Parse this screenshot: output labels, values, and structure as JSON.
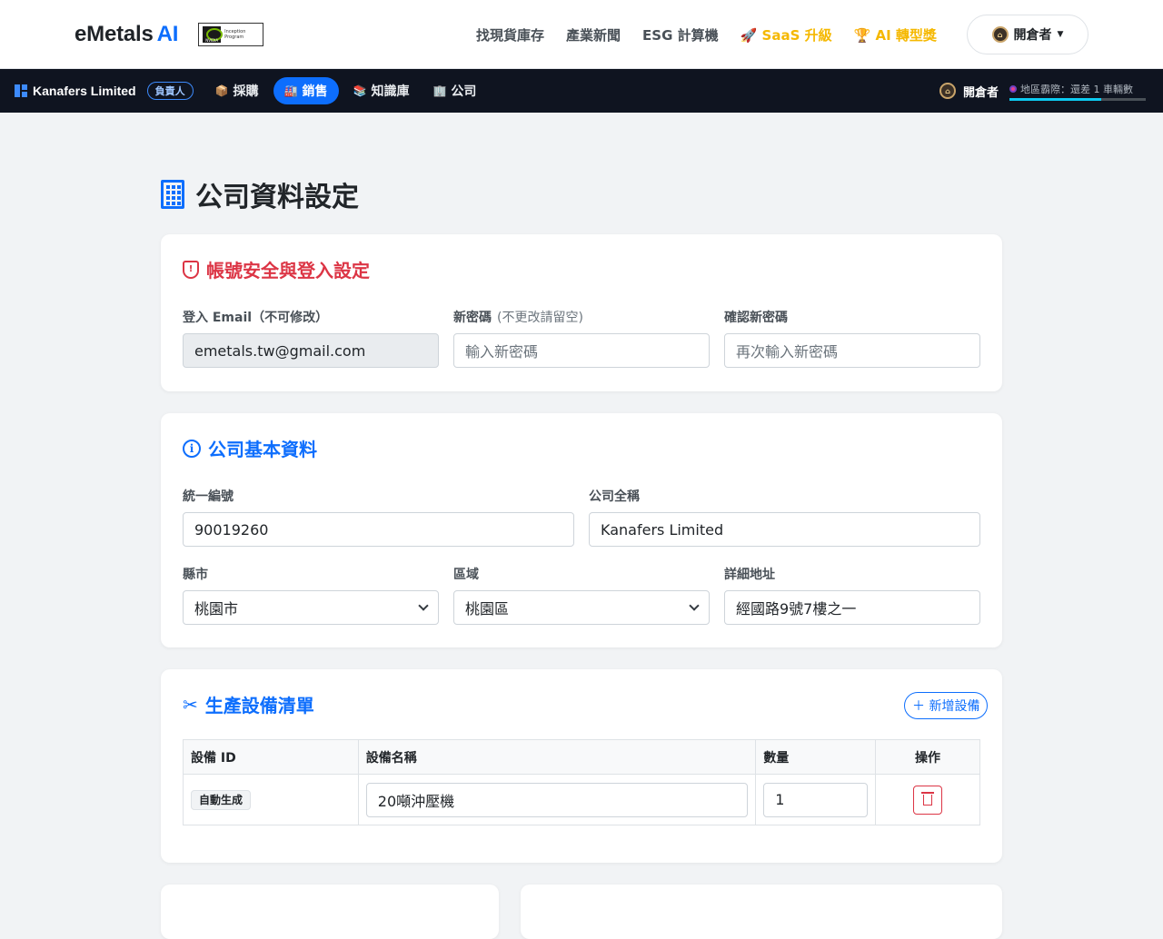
{
  "header": {
    "brand": "eMetals",
    "brand_ai": "AI",
    "badge_brand": "NVIDIA",
    "badge_text": "Inception Program",
    "nav": [
      {
        "label": "找現貨庫存"
      },
      {
        "label": "產業新聞"
      },
      {
        "label": "ESG 計算機"
      },
      {
        "label": "🚀 SaaS 升級"
      },
      {
        "label": "🏆 AI 轉型獎"
      }
    ],
    "user_label": "開倉者"
  },
  "subnav": {
    "company": "Kanafers Limited",
    "role": "負責人",
    "tabs": [
      {
        "icon": "📦",
        "label": "採購"
      },
      {
        "icon": "🏭",
        "label": "銷售"
      },
      {
        "icon": "📚",
        "label": "知識庫"
      },
      {
        "icon": "🏢",
        "label": "公司"
      }
    ],
    "user_label": "開倉者",
    "progress_text": "地區霸際：還差 1 車輛數",
    "progress_fraction": 0.67
  },
  "page": {
    "title": "公司資料設定"
  },
  "security": {
    "title": "帳號安全與登入設定",
    "email_label": "登入 Email（不可修改）",
    "email_value": "emetals.tw@gmail.com",
    "new_password_label": "新密碼",
    "new_password_hint": "(不更改請留空)",
    "new_password_placeholder": "輸入新密碼",
    "confirm_password_label": "確認新密碼",
    "confirm_password_placeholder": "再次輸入新密碼"
  },
  "company_info": {
    "title": "公司基本資料",
    "tax_id_label": "統一編號",
    "tax_id_value": "90019260",
    "full_name_label": "公司全稱",
    "full_name_value": "Kanafers Limited",
    "city_label": "縣市",
    "city_value": "桃園市",
    "district_label": "區域",
    "district_value": "桃園區",
    "address_label": "詳細地址",
    "address_value": "經國路9號7樓之一"
  },
  "equipment": {
    "title": "生產設備清單",
    "add_label": "＋ 新增設備",
    "columns": [
      "設備 ID",
      "設備名稱",
      "數量",
      "操作"
    ],
    "rows": [
      {
        "id": "自動生成",
        "name": "20噸沖壓機",
        "qty": "1"
      }
    ]
  }
}
